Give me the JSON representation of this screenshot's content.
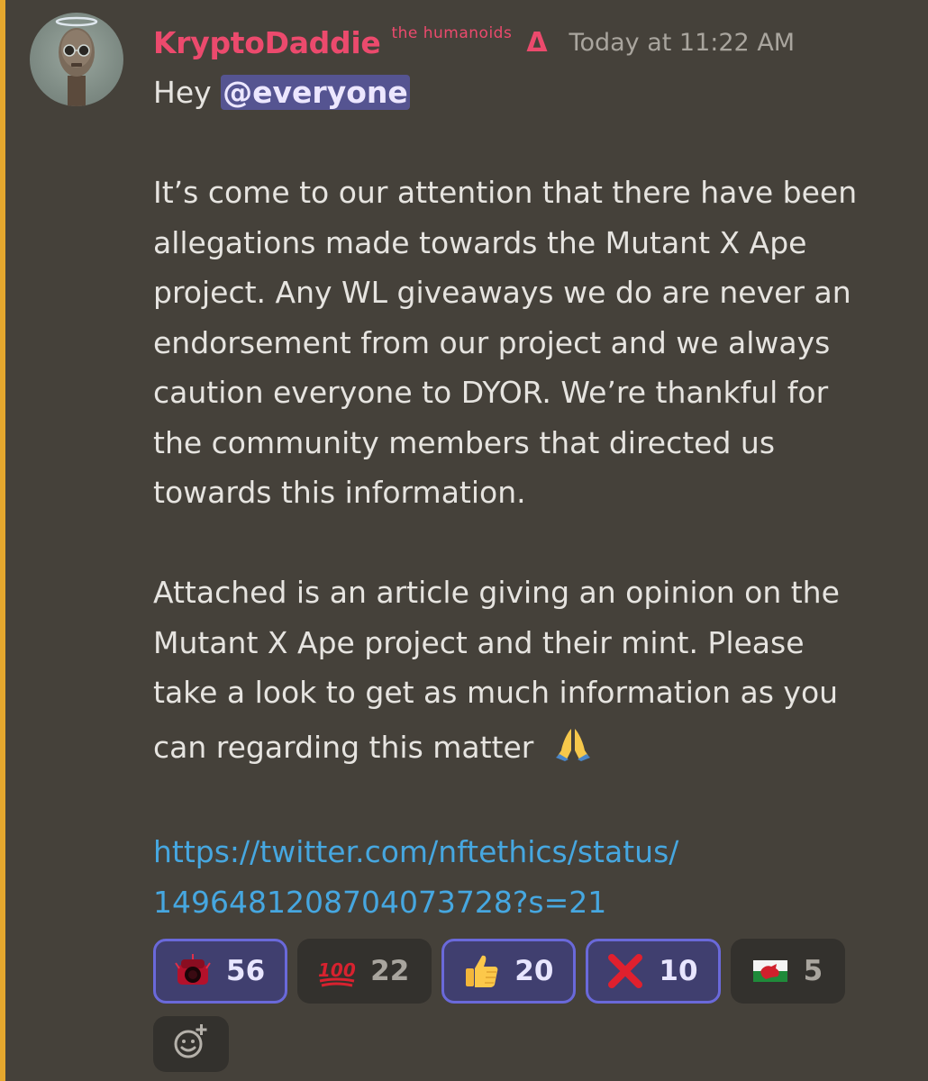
{
  "message": {
    "author": "KryptoDaddie",
    "role_tag": "the humanoids",
    "role_icon": "Δ",
    "timestamp": "Today at 11:22 AM",
    "greeting": "Hey",
    "mention": "@everyone",
    "paragraph1": [
      "It’s come to our attention that there have been",
      "allegations made towards the Mutant X Ape",
      "project.  Any WL giveaways we do are never an",
      "endorsement from our project and we always",
      "caution everyone to DYOR.  We’re thankful for",
      "the community members that directed us",
      "towards this information."
    ],
    "paragraph2": [
      "Attached is an article giving an opinion on the",
      "Mutant X Ape project and their mint. Please",
      "take a look to get as much information as you",
      "can regarding this matter"
    ],
    "link_lines": [
      "https://twitter.com/nftethics/status/",
      "1496481208704073728?s=21"
    ]
  },
  "reactions": [
    {
      "emoji": "red-orb-emoji",
      "count": "56",
      "me": true
    },
    {
      "emoji": "hundred-points-emoji",
      "count": "22",
      "me": false
    },
    {
      "emoji": "thumbs-up-emoji",
      "count": "20",
      "me": true
    },
    {
      "emoji": "cross-mark-emoji",
      "count": "10",
      "me": true
    },
    {
      "emoji": "wales-flag-emoji",
      "count": "5",
      "me": false
    }
  ],
  "icons": {
    "pray": "folded-hands-emoji",
    "add_reaction": "add-reaction-icon"
  },
  "colors": {
    "background": "#45413a",
    "accent_bar": "#e4a72e",
    "username": "#ec4a6d",
    "link": "#46a7e0",
    "mention_bg": "#555491",
    "reaction_selected_border": "#6a69da"
  }
}
